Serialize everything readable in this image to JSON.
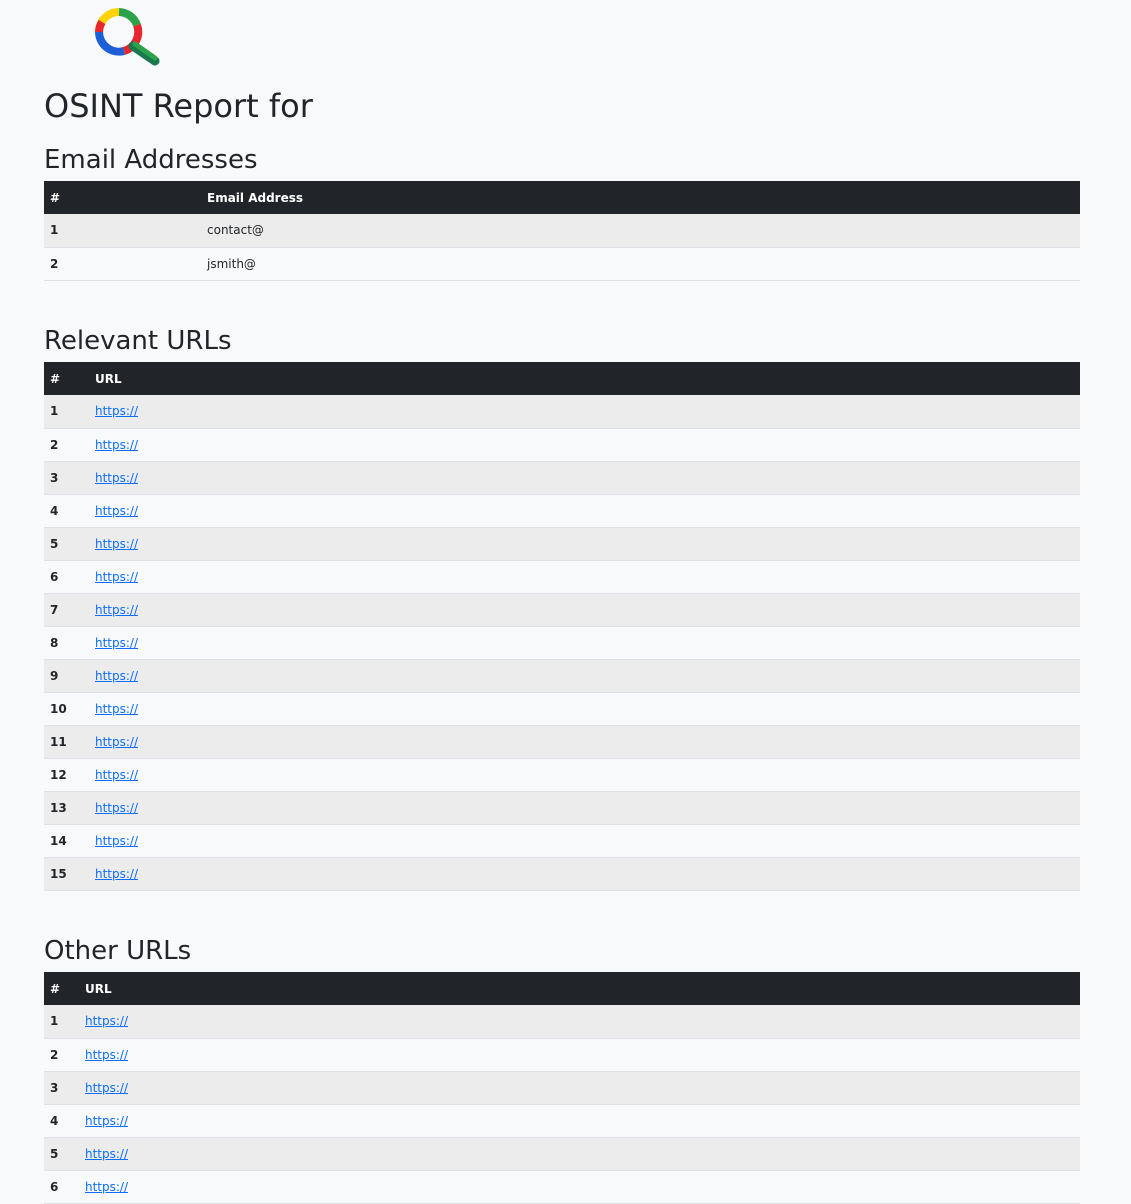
{
  "report": {
    "title": "OSINT Report for",
    "logo_icon": "magnifier-logo-icon"
  },
  "emails": {
    "heading": "Email Addresses",
    "columns": [
      "#",
      "Email Address"
    ],
    "rows": [
      {
        "num": "1",
        "value": "contact@"
      },
      {
        "num": "2",
        "value": "jsmith@"
      }
    ]
  },
  "relevant_urls": {
    "heading": "Relevant URLs",
    "columns": [
      "#",
      "URL"
    ],
    "rows": [
      {
        "num": "1",
        "value": "https://"
      },
      {
        "num": "2",
        "value": "https://"
      },
      {
        "num": "3",
        "value": "https://"
      },
      {
        "num": "4",
        "value": "https://"
      },
      {
        "num": "5",
        "value": "https://"
      },
      {
        "num": "6",
        "value": "https://"
      },
      {
        "num": "7",
        "value": "https://"
      },
      {
        "num": "8",
        "value": "https://"
      },
      {
        "num": "9",
        "value": "https://"
      },
      {
        "num": "10",
        "value": "https://"
      },
      {
        "num": "11",
        "value": "https://"
      },
      {
        "num": "12",
        "value": "https://"
      },
      {
        "num": "13",
        "value": "https://"
      },
      {
        "num": "14",
        "value": "https://"
      },
      {
        "num": "15",
        "value": "https://"
      }
    ]
  },
  "other_urls": {
    "heading": "Other URLs",
    "columns": [
      "#",
      "URL"
    ],
    "rows": [
      {
        "num": "1",
        "value": "https://"
      },
      {
        "num": "2",
        "value": "https://"
      },
      {
        "num": "3",
        "value": "https://"
      },
      {
        "num": "4",
        "value": "https://"
      },
      {
        "num": "5",
        "value": "https://"
      },
      {
        "num": "6",
        "value": "https://"
      }
    ]
  },
  "colors": {
    "header_bg": "#212529",
    "link": "#0d6efd",
    "stripe": "#ececed",
    "page_bg": "#f8f9fa"
  }
}
